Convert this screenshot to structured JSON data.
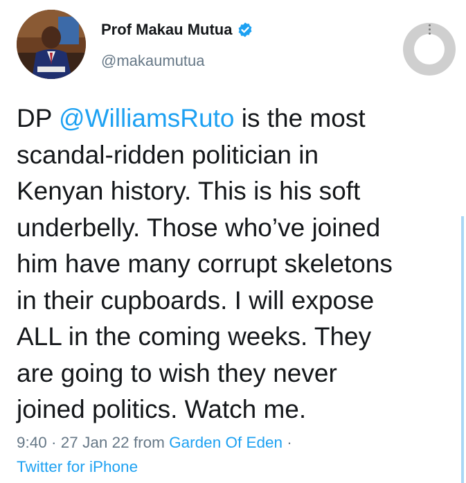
{
  "author": {
    "name": "Prof Makau Mutua",
    "handle": "@makaumutua",
    "verified": true,
    "verified_icon": "verified-badge-icon",
    "verified_color": "#1da1f2"
  },
  "tweet": {
    "lines": [
      {
        "prefix": "DP ",
        "mention": "@WilliamsRuto",
        "suffix": " is the most"
      },
      "scandal-ridden politician in",
      "Kenyan history.  This is his soft",
      "underbelly.  Those who’ve joined",
      "him have many corrupt skeletons",
      "in their cupboards.  I will expose",
      "ALL in the coming weeks.  They",
      "are going to wish they never",
      "joined politics.  Watch me."
    ]
  },
  "meta": {
    "time": "9:40",
    "separator": " · ",
    "date": "27 Jan 22",
    "from_label": " from ",
    "location": "Garden Of Eden",
    "trailing_separator": " ·",
    "source": "Twitter for iPhone"
  },
  "colors": {
    "link": "#1da1f2",
    "secondary_text": "#657786",
    "primary_text": "#14171a"
  },
  "icons": {
    "menu": "more-options-icon"
  }
}
